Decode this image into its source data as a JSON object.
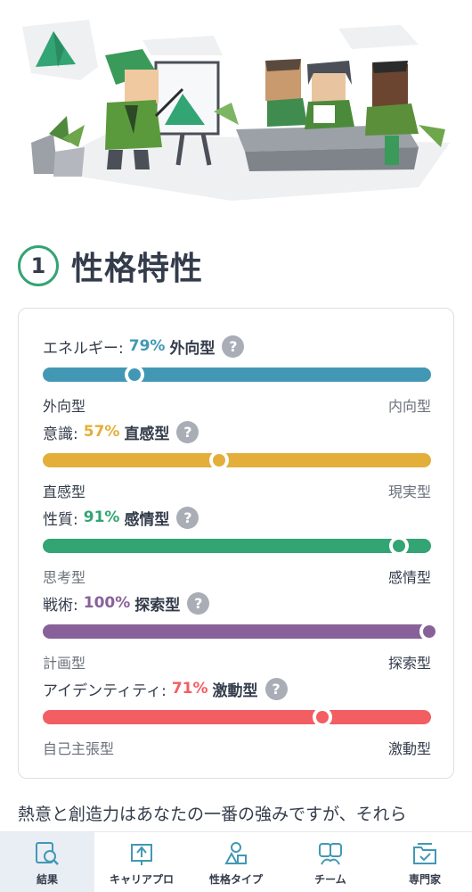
{
  "section": {
    "number": "1",
    "title": "性格特性"
  },
  "traits": [
    {
      "label": "エネルギー:",
      "percent": "79%",
      "type": "外向型",
      "left_end": "外向型",
      "right_end": "内向型",
      "color": "#4298b4",
      "position": 0.236
    },
    {
      "label": "意識:",
      "percent": "57%",
      "type": "直感型",
      "left_end": "直感型",
      "right_end": "現実型",
      "color": "#e4ae3a",
      "position": 0.454
    },
    {
      "label": "性質:",
      "percent": "91%",
      "type": "感情型",
      "left_end": "思考型",
      "right_end": "感情型",
      "color": "#33a474",
      "position": 0.917
    },
    {
      "label": "戦術:",
      "percent": "100%",
      "type": "探索型",
      "left_end": "計画型",
      "right_end": "探索型",
      "color": "#88619a",
      "position": 1.0
    },
    {
      "label": "アイデンティティ:",
      "percent": "71%",
      "type": "激動型",
      "left_end": "自己主張型",
      "right_end": "激動型",
      "color": "#f25e62",
      "position": 0.72
    }
  ],
  "help_icon": "?",
  "description": "熱意と創造力はあなたの一番の強みですが、それら",
  "tabs": [
    {
      "label": "結果",
      "icon": "magnifier-report-icon",
      "active": true
    },
    {
      "label": "キャリアプロ",
      "icon": "upload-board-icon",
      "active": false
    },
    {
      "label": "性格タイプ",
      "icon": "shapes-icon",
      "active": false
    },
    {
      "label": "チーム",
      "icon": "team-icon",
      "active": false
    },
    {
      "label": "専門家",
      "icon": "folder-check-icon",
      "active": false
    }
  ]
}
